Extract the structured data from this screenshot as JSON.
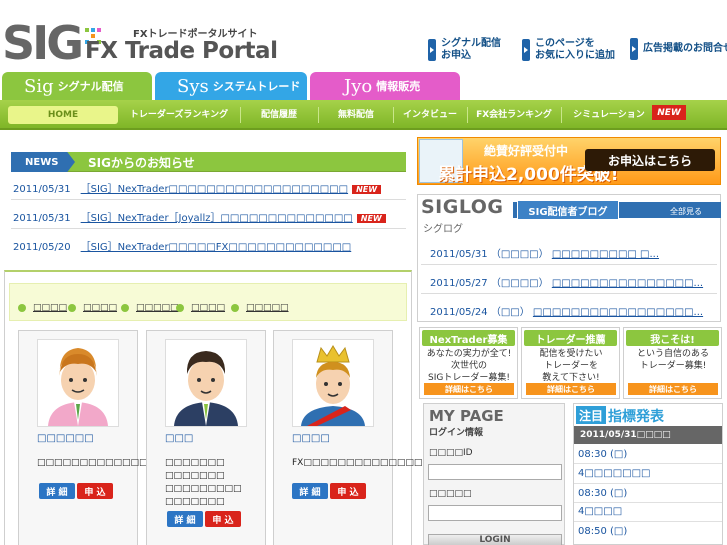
{
  "header": {
    "logo_sig": "SIG",
    "logo_sub": "FXトレードポータルサイト",
    "logo_main": "FX Trade Portal",
    "links": [
      {
        "label": "シグナル配信\nお申込"
      },
      {
        "label": "このページを\nお気に入りに追加"
      },
      {
        "label": "広告掲載のお問合せ"
      }
    ]
  },
  "category_tabs": [
    {
      "big": "Sig",
      "label": "シグナル配信",
      "color": "#8cc63f"
    },
    {
      "big": "Sys",
      "label": "システムトレード",
      "color": "#33a6e6"
    },
    {
      "big": "Jyo",
      "label": "情報販売",
      "color": "#e45cc9"
    }
  ],
  "nav": {
    "home": "HOME",
    "items": [
      "トレーダーズランキング",
      "配信履歴",
      "無料配信",
      "インタビュー",
      "FX会社ランキング",
      "シミュレーション"
    ],
    "new_badge": "NEW"
  },
  "news": {
    "tag": "NEWS",
    "title": "SIGからのお知らせ",
    "items": [
      {
        "date": "2011/05/31",
        "text": "［SIG］NexTrader□□□□□□□□□□□□□□□□□□□",
        "new": "NEW"
      },
      {
        "date": "2011/05/31",
        "text": "［SIG］NexTrader［Joyallz］□□□□□□□□□□□□□□",
        "new": "NEW"
      },
      {
        "date": "2011/05/20",
        "text": "［SIG］NexTrader□□□□□FX□□□□□□□□□□□□□",
        "new": ""
      }
    ]
  },
  "filters": [
    "□□□□",
    "□□□□",
    "□□□□□",
    "□□□□",
    "□□□□□"
  ],
  "traders": [
    {
      "name": "□□□□□□",
      "desc": "□□□□□□□□□□□□□□□□□□□□□□□□□",
      "detail": "詳 細",
      "apply": "申 込"
    },
    {
      "name": "□□□",
      "desc": "□□□□□□□ □□□□□□□ □□□□□□□□□ □□□□□□□",
      "detail": "詳 細",
      "apply": "申 込"
    },
    {
      "name": "□□□□",
      "desc": "FX□□□□□□□□□□□□□□□□",
      "detail": "詳 細",
      "apply": "申 込"
    }
  ],
  "banner": {
    "line1": "絶賛好評受付中",
    "line2": "累計申込2,000件突破!",
    "cta": "お申込はこちら"
  },
  "siglog": {
    "title": "SIGLOG",
    "sub": "シグログ",
    "tag": "SIG配信者ブログ",
    "all": "全部見る",
    "items": [
      {
        "date": "2011/05/31",
        "author": "（□□□□）",
        "text": "□□□□□□□□□ □..."
      },
      {
        "date": "2011/05/27",
        "author": "（□□□□）",
        "text": "□□□□□□□□□□□□□□□..."
      },
      {
        "date": "2011/05/24",
        "author": "（□□）",
        "text": "□□□□□□□□□□□□□□□□□..."
      }
    ]
  },
  "promos": [
    {
      "head": "NexTrader募集",
      "body": "あなたの実力が全て!\n次世代の\nSIGトレーダー募集!",
      "btn": "詳細はこちら"
    },
    {
      "head": "トレーダー推薦",
      "body": "配信を受けたい\nトレーダーを\n教えて下さい!",
      "btn": "詳細はこちら"
    },
    {
      "head": "我こそは!",
      "body": "という自信のある\nトレーダー募集!",
      "btn": "詳細はこちら"
    }
  ],
  "mypage": {
    "title": "MY PAGE",
    "sub": "ログイン情報",
    "id_label": "□□□□ID",
    "pw_label": "□□□□□",
    "login": "LOGIN"
  },
  "indicator": {
    "tag": "注目",
    "title": "指標発表",
    "date": "2011/05/31□□□□",
    "rows": [
      {
        "time": "08:30",
        "day": "(□)"
      },
      {
        "time": "",
        "day": "4□□□□□□□"
      },
      {
        "time": "08:30",
        "day": "(□)"
      },
      {
        "time": "",
        "day": "4□□□□"
      },
      {
        "time": "08:50",
        "day": "(□)"
      }
    ]
  }
}
